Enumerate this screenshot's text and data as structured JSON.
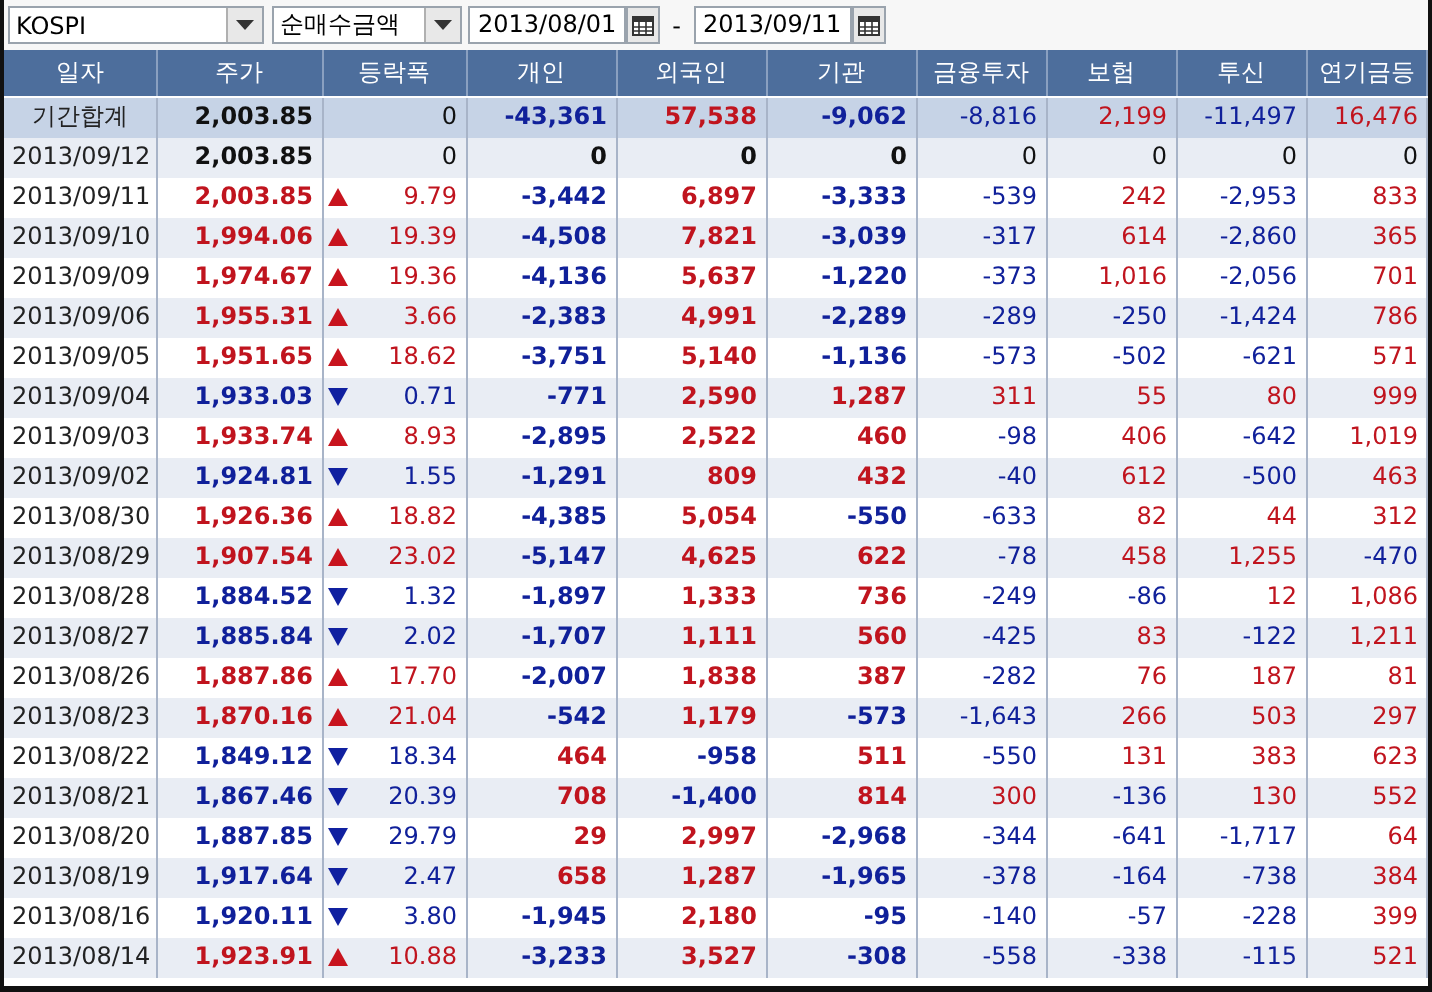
{
  "toolbar": {
    "market": "KOSPI",
    "measure": "순매수금액",
    "date_from": "2013/08/01",
    "separator": "-",
    "date_to": "2013/09/11"
  },
  "table": {
    "columns": [
      "일자",
      "주가",
      "등락폭",
      "개인",
      "외국인",
      "기관",
      "금융투자",
      "보험",
      "투신",
      "연기금등"
    ],
    "rows": [
      {
        "kind": "total",
        "date": "기간합계",
        "price": "2,003.85",
        "up": false,
        "down": false,
        "change": "0",
        "values": [
          "-43,361",
          "57,538",
          "-9,062",
          "-8,816",
          "2,199",
          "-11,497",
          "16,476"
        ]
      },
      {
        "kind": "day",
        "date": "2013/09/12",
        "price": "2,003.85",
        "up": false,
        "down": false,
        "change": "0",
        "values": [
          "0",
          "0",
          "0",
          "0",
          "0",
          "0",
          "0"
        ]
      },
      {
        "kind": "day",
        "date": "2013/09/11",
        "price": "2,003.85",
        "up": true,
        "down": false,
        "change": "9.79",
        "values": [
          "-3,442",
          "6,897",
          "-3,333",
          "-539",
          "242",
          "-2,953",
          "833"
        ]
      },
      {
        "kind": "day",
        "date": "2013/09/10",
        "price": "1,994.06",
        "up": true,
        "down": false,
        "change": "19.39",
        "values": [
          "-4,508",
          "7,821",
          "-3,039",
          "-317",
          "614",
          "-2,860",
          "365"
        ]
      },
      {
        "kind": "day",
        "date": "2013/09/09",
        "price": "1,974.67",
        "up": true,
        "down": false,
        "change": "19.36",
        "values": [
          "-4,136",
          "5,637",
          "-1,220",
          "-373",
          "1,016",
          "-2,056",
          "701"
        ]
      },
      {
        "kind": "day",
        "date": "2013/09/06",
        "price": "1,955.31",
        "up": true,
        "down": false,
        "change": "3.66",
        "values": [
          "-2,383",
          "4,991",
          "-2,289",
          "-289",
          "-250",
          "-1,424",
          "786"
        ]
      },
      {
        "kind": "day",
        "date": "2013/09/05",
        "price": "1,951.65",
        "up": true,
        "down": false,
        "change": "18.62",
        "values": [
          "-3,751",
          "5,140",
          "-1,136",
          "-573",
          "-502",
          "-621",
          "571"
        ]
      },
      {
        "kind": "day",
        "date": "2013/09/04",
        "price": "1,933.03",
        "up": false,
        "down": true,
        "change": "0.71",
        "values": [
          "-771",
          "2,590",
          "1,287",
          "311",
          "55",
          "80",
          "999"
        ]
      },
      {
        "kind": "day",
        "date": "2013/09/03",
        "price": "1,933.74",
        "up": true,
        "down": false,
        "change": "8.93",
        "values": [
          "-2,895",
          "2,522",
          "460",
          "-98",
          "406",
          "-642",
          "1,019"
        ]
      },
      {
        "kind": "day",
        "date": "2013/09/02",
        "price": "1,924.81",
        "up": false,
        "down": true,
        "change": "1.55",
        "values": [
          "-1,291",
          "809",
          "432",
          "-40",
          "612",
          "-500",
          "463"
        ]
      },
      {
        "kind": "day",
        "date": "2013/08/30",
        "price": "1,926.36",
        "up": true,
        "down": false,
        "change": "18.82",
        "values": [
          "-4,385",
          "5,054",
          "-550",
          "-633",
          "82",
          "44",
          "312"
        ]
      },
      {
        "kind": "day",
        "date": "2013/08/29",
        "price": "1,907.54",
        "up": true,
        "down": false,
        "change": "23.02",
        "values": [
          "-5,147",
          "4,625",
          "622",
          "-78",
          "458",
          "1,255",
          "-470"
        ]
      },
      {
        "kind": "day",
        "date": "2013/08/28",
        "price": "1,884.52",
        "up": false,
        "down": true,
        "change": "1.32",
        "values": [
          "-1,897",
          "1,333",
          "736",
          "-249",
          "-86",
          "12",
          "1,086"
        ]
      },
      {
        "kind": "day",
        "date": "2013/08/27",
        "price": "1,885.84",
        "up": false,
        "down": true,
        "change": "2.02",
        "values": [
          "-1,707",
          "1,111",
          "560",
          "-425",
          "83",
          "-122",
          "1,211"
        ]
      },
      {
        "kind": "day",
        "date": "2013/08/26",
        "price": "1,887.86",
        "up": true,
        "down": false,
        "change": "17.70",
        "values": [
          "-2,007",
          "1,838",
          "387",
          "-282",
          "76",
          "187",
          "81"
        ]
      },
      {
        "kind": "day",
        "date": "2013/08/23",
        "price": "1,870.16",
        "up": true,
        "down": false,
        "change": "21.04",
        "values": [
          "-542",
          "1,179",
          "-573",
          "-1,643",
          "266",
          "503",
          "297"
        ]
      },
      {
        "kind": "day",
        "date": "2013/08/22",
        "price": "1,849.12",
        "up": false,
        "down": true,
        "change": "18.34",
        "values": [
          "464",
          "-958",
          "511",
          "-550",
          "131",
          "383",
          "623"
        ]
      },
      {
        "kind": "day",
        "date": "2013/08/21",
        "price": "1,867.46",
        "up": false,
        "down": true,
        "change": "20.39",
        "values": [
          "708",
          "-1,400",
          "814",
          "300",
          "-136",
          "130",
          "552"
        ]
      },
      {
        "kind": "day",
        "date": "2013/08/20",
        "price": "1,887.85",
        "up": false,
        "down": true,
        "change": "29.79",
        "values": [
          "29",
          "2,997",
          "-2,968",
          "-344",
          "-641",
          "-1,717",
          "64"
        ]
      },
      {
        "kind": "day",
        "date": "2013/08/19",
        "price": "1,917.64",
        "up": false,
        "down": true,
        "change": "2.47",
        "values": [
          "658",
          "1,287",
          "-1,965",
          "-378",
          "-164",
          "-738",
          "384"
        ]
      },
      {
        "kind": "day",
        "date": "2013/08/16",
        "price": "1,920.11",
        "up": false,
        "down": true,
        "change": "3.80",
        "values": [
          "-1,945",
          "2,180",
          "-95",
          "-140",
          "-57",
          "-228",
          "399"
        ]
      },
      {
        "kind": "day",
        "date": "2013/08/14",
        "price": "1,923.91",
        "up": true,
        "down": false,
        "change": "10.88",
        "values": [
          "-3,233",
          "3,527",
          "-308",
          "-558",
          "-338",
          "-115",
          "521"
        ]
      }
    ]
  }
}
